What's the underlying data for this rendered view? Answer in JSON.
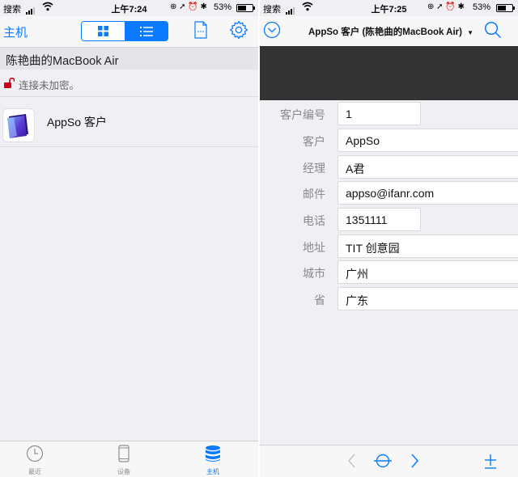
{
  "left": {
    "status": {
      "carrier": "搜索",
      "time": "上午7:24",
      "battery": "53%"
    },
    "nav": {
      "host_link": "主机"
    },
    "server": {
      "name": "陈艳曲的MacBook Air",
      "encryption": "连接未加密。"
    },
    "files": [
      {
        "name": "AppSo 客户"
      }
    ],
    "tabs": [
      {
        "label": "最近",
        "icon": "clock-icon"
      },
      {
        "label": "设备",
        "icon": "device-icon"
      },
      {
        "label": "主机",
        "icon": "database-icon",
        "active": true
      }
    ],
    "colors": {
      "accent": "#0a7aff",
      "lock": "#d0021b"
    }
  },
  "right": {
    "status": {
      "carrier": "搜索",
      "time": "上午7:25",
      "battery": "53%"
    },
    "nav": {
      "title": "AppSo 客户 (陈艳曲的MacBook Air)",
      "dropdown_arrow": "▼"
    },
    "form": {
      "fields": [
        {
          "label": "客户编号",
          "value": "1"
        },
        {
          "label": "客户",
          "value": "AppSo"
        },
        {
          "label": "经理",
          "value": "A君"
        },
        {
          "label": "邮件",
          "value": "appso@ifanr.com"
        },
        {
          "label": "电话",
          "value": "1351111"
        },
        {
          "label": "地址",
          "value": " TIT 创意园"
        },
        {
          "label": "城市",
          "value": "广州"
        },
        {
          "label": "省",
          "value": "广东"
        }
      ]
    },
    "colors": {
      "header_band": "#333333",
      "accent": "#0a7aff"
    }
  }
}
